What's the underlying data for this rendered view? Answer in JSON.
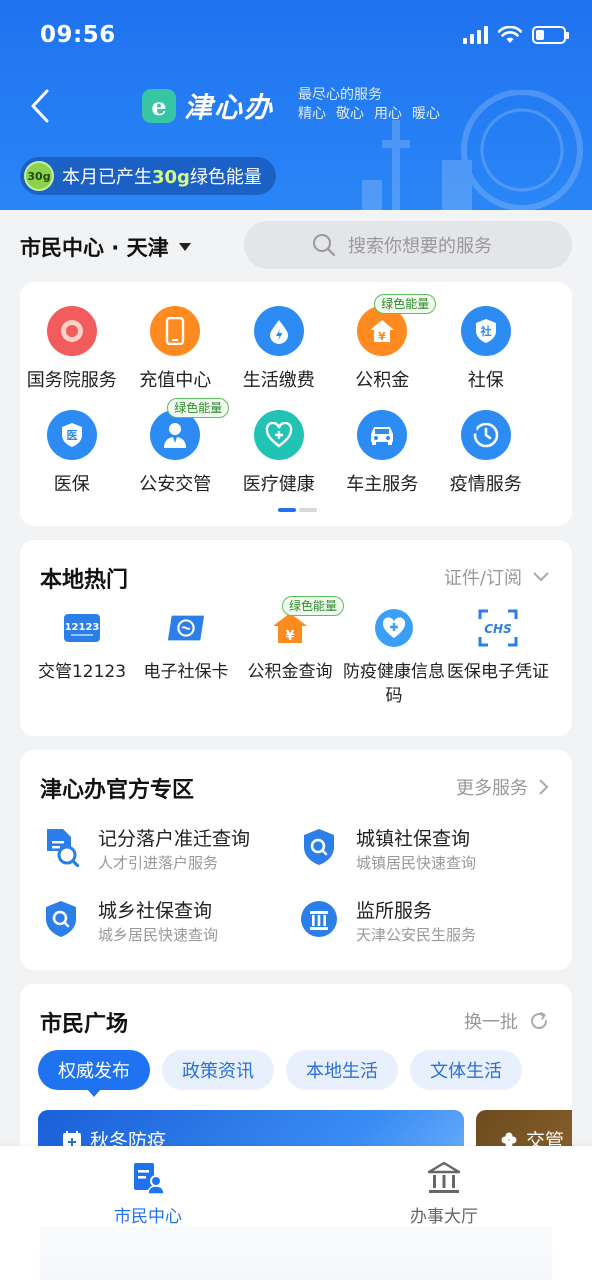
{
  "status_bar": {
    "time": "09:56"
  },
  "header": {
    "logo_mark": "e",
    "logo_text": "津心办",
    "slogan_line1": "最尽心的服务",
    "slogan_line2": [
      "精心",
      "敬心",
      "用心",
      "暖心"
    ],
    "energy": {
      "badge": "30g",
      "prefix": "本月已产生",
      "amount": "30g",
      "suffix": "绿色能量"
    }
  },
  "city": {
    "label": "市民中心 · 天津"
  },
  "search": {
    "placeholder": "搜索你想要的服务"
  },
  "service_grid": {
    "row1": [
      {
        "label": "国务院服务",
        "icon": "state-council-icon",
        "color": "#f25c5c"
      },
      {
        "label": "充值中心",
        "icon": "phone-icon",
        "color": "#ff8a1f"
      },
      {
        "label": "生活缴费",
        "icon": "water-drop-icon",
        "color": "#2c8cf4"
      },
      {
        "label": "公积金",
        "icon": "house-fund-icon",
        "color": "#ff8a1f",
        "tag": "绿色能量"
      },
      {
        "label": "社保",
        "icon": "social-security-icon",
        "color": "#2c8cf4"
      }
    ],
    "row2": [
      {
        "label": "医保",
        "icon": "medical-insurance-icon",
        "color": "#2c8cf4"
      },
      {
        "label": "公安交管",
        "icon": "police-icon",
        "color": "#2c8cf4",
        "tag": "绿色能量"
      },
      {
        "label": "医疗健康",
        "icon": "health-icon",
        "color": "#22c3b5"
      },
      {
        "label": "车主服务",
        "icon": "car-icon",
        "color": "#2c8cf4"
      },
      {
        "label": "疫情服务",
        "icon": "epidemic-clock-icon",
        "color": "#2c8cf4"
      }
    ]
  },
  "hot": {
    "title": "本地热门",
    "more": "证件/订阅",
    "items": [
      {
        "label": "交管12123",
        "icon": "traffic-12123-icon"
      },
      {
        "label": "电子社保卡",
        "icon": "social-card-icon"
      },
      {
        "label": "公积金查询",
        "icon": "house-fund-query-icon",
        "tag": "绿色能量"
      },
      {
        "label": "防疫健康信息码",
        "icon": "health-code-icon"
      },
      {
        "label": "医保电子凭证",
        "icon": "chs-voucher-icon"
      }
    ]
  },
  "official": {
    "title": "津心办官方专区",
    "more": "更多服务",
    "items": [
      {
        "title": "记分落户准迁查询",
        "sub": "人才引进落户服务",
        "icon": "document-search-icon"
      },
      {
        "title": "城镇社保查询",
        "sub": "城镇居民快速查询",
        "icon": "shield-search-icon"
      },
      {
        "title": "城乡社保查询",
        "sub": "城乡居民快速查询",
        "icon": "shield-search-icon"
      },
      {
        "title": "监所服务",
        "sub": "天津公安民生服务",
        "icon": "building-pillars-icon"
      }
    ]
  },
  "plaza": {
    "title": "市民广场",
    "refresh": "换一批",
    "tabs": [
      "权威发布",
      "政策资讯",
      "本地生活",
      "文体生活"
    ],
    "banners": [
      "秋冬防疫",
      "交管"
    ]
  },
  "tabbar": {
    "items": [
      {
        "label": "市民中心",
        "active": true
      },
      {
        "label": "办事大厅",
        "active": false
      }
    ],
    "colors": {
      "active": "#1f72f0",
      "inactive": "#666666"
    }
  }
}
